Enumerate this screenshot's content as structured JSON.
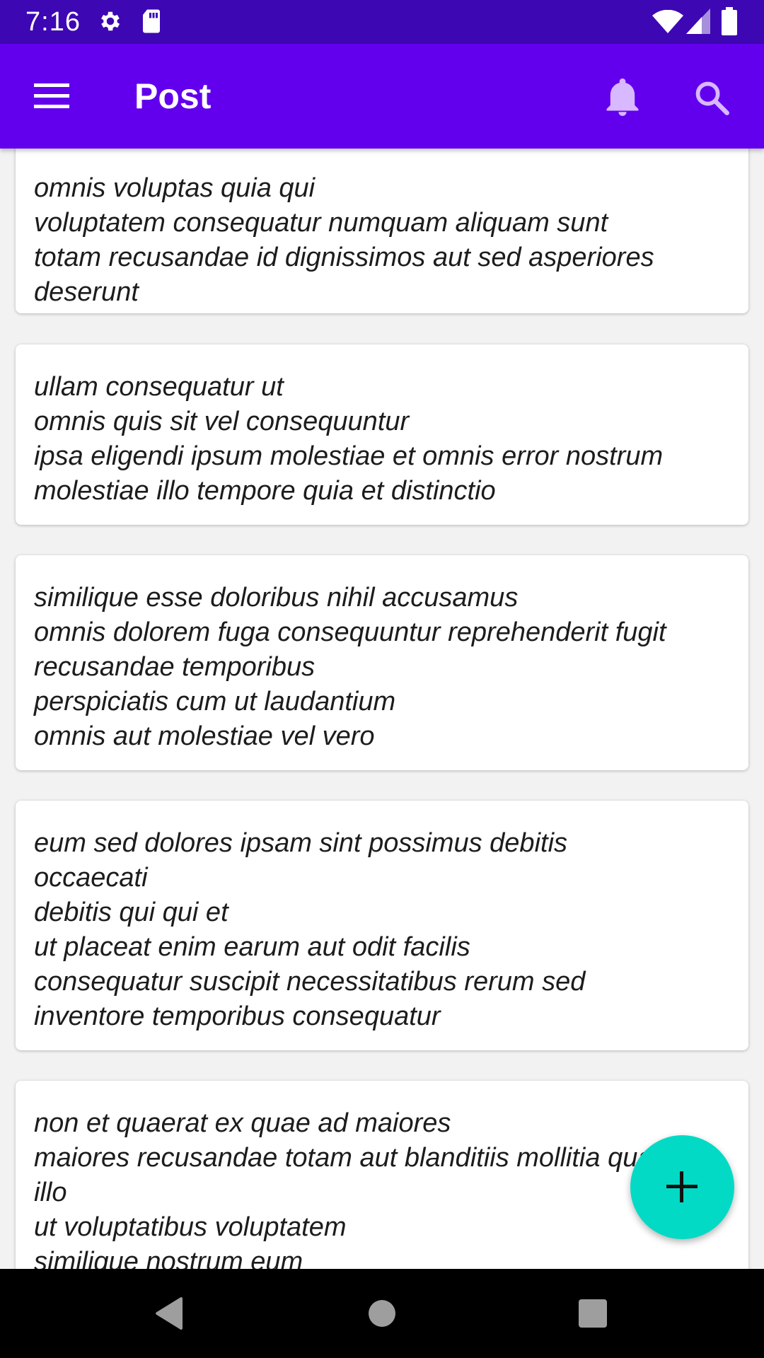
{
  "status_bar": {
    "time": "7:16",
    "icons": [
      "settings-icon",
      "sd-card-icon",
      "wifi-icon",
      "cell-signal-icon",
      "battery-icon"
    ]
  },
  "app_bar": {
    "title": "Post",
    "menu_icon": "menu-icon",
    "actions": [
      "bell-icon",
      "search-icon"
    ],
    "background": "#6200ee",
    "status_background": "#3e07b4"
  },
  "posts": [
    {
      "body": "omnis voluptas quia qui\nvoluptatem consequatur numquam aliquam sunt\ntotam recusandae id dignissimos aut sed asperiores\ndeserunt"
    },
    {
      "body": "ullam consequatur ut\nomnis quis sit vel consequuntur\nipsa eligendi ipsum molestiae et omnis error nostrum\nmolestiae illo tempore quia et distinctio"
    },
    {
      "body": "similique esse doloribus nihil accusamus\nomnis dolorem fuga consequuntur reprehenderit fugit\nrecusandae temporibus\nperspiciatis cum ut laudantium\nomnis aut molestiae vel vero"
    },
    {
      "body": "eum sed dolores ipsam sint possimus debitis\noccaecati\ndebitis qui qui et\nut placeat enim earum aut odit facilis\nconsequatur suscipit necessitatibus rerum sed\ninventore temporibus consequatur"
    },
    {
      "body": "non et quaerat ex quae ad maiores\nmaiores recusandae totam aut blanditiis mollitia quas\nillo\nut voluptatibus voluptatem\nsimilique nostrum eum"
    }
  ],
  "fab": {
    "icon": "plus-icon",
    "color": "#03dac5"
  },
  "nav_bar": {
    "buttons": [
      "back-icon",
      "home-icon",
      "recents-icon"
    ]
  }
}
